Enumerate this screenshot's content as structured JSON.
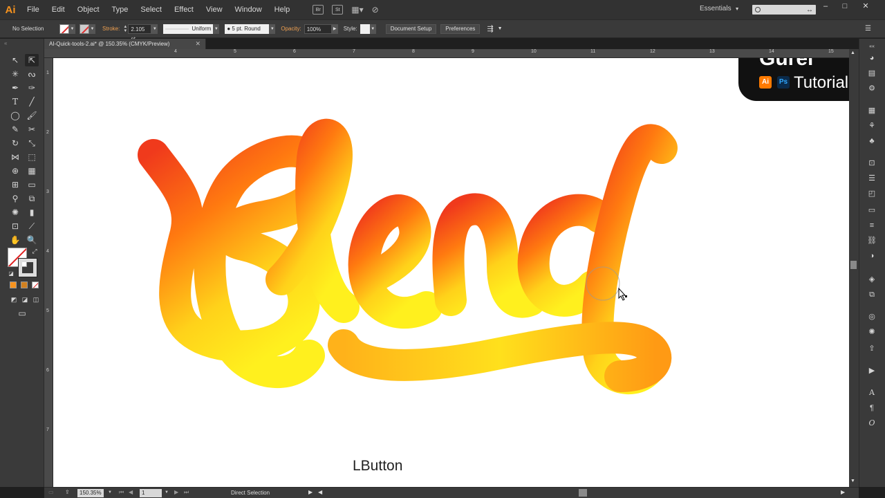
{
  "app": {
    "logo": "Ai",
    "workspace": "Essentials"
  },
  "menu": [
    "File",
    "Edit",
    "Object",
    "Type",
    "Select",
    "Effect",
    "View",
    "Window",
    "Help"
  ],
  "menu_buttons": {
    "bridge": "Br",
    "stock": "St"
  },
  "control": {
    "selection": "No Selection",
    "stroke_label": "Stroke:",
    "stroke_weight": "2.105 pt",
    "profile": "Uniform",
    "brush": "5 pt. Round",
    "opacity_label": "Opacity:",
    "opacity": "100%",
    "style_label": "Style:",
    "document_setup": "Document Setup",
    "preferences": "Preferences"
  },
  "document": {
    "tab_title": "AI-Quick-tools-2.ai* @ 150.35% (CMYK/Preview)",
    "ruler_top": [
      "4",
      "5",
      "6",
      "7",
      "8",
      "9",
      "10",
      "11",
      "12",
      "13",
      "14",
      "15"
    ],
    "ruler_left": [
      "1",
      "2",
      "3",
      "4",
      "5",
      "6",
      "7"
    ]
  },
  "artwork": {
    "word": "Blend",
    "gradient_colors": [
      "#f03a1c",
      "#ff7a10",
      "#ffd21a",
      "#fff01e"
    ]
  },
  "overlay": {
    "badge_top": "Gurel",
    "ai_chip": "Ai",
    "ps_chip": "Ps",
    "badge_text": "Tutorial",
    "caption": "LButton"
  },
  "status": {
    "zoom": "150.35%",
    "artboard": "1",
    "tool": "Direct Selection"
  }
}
